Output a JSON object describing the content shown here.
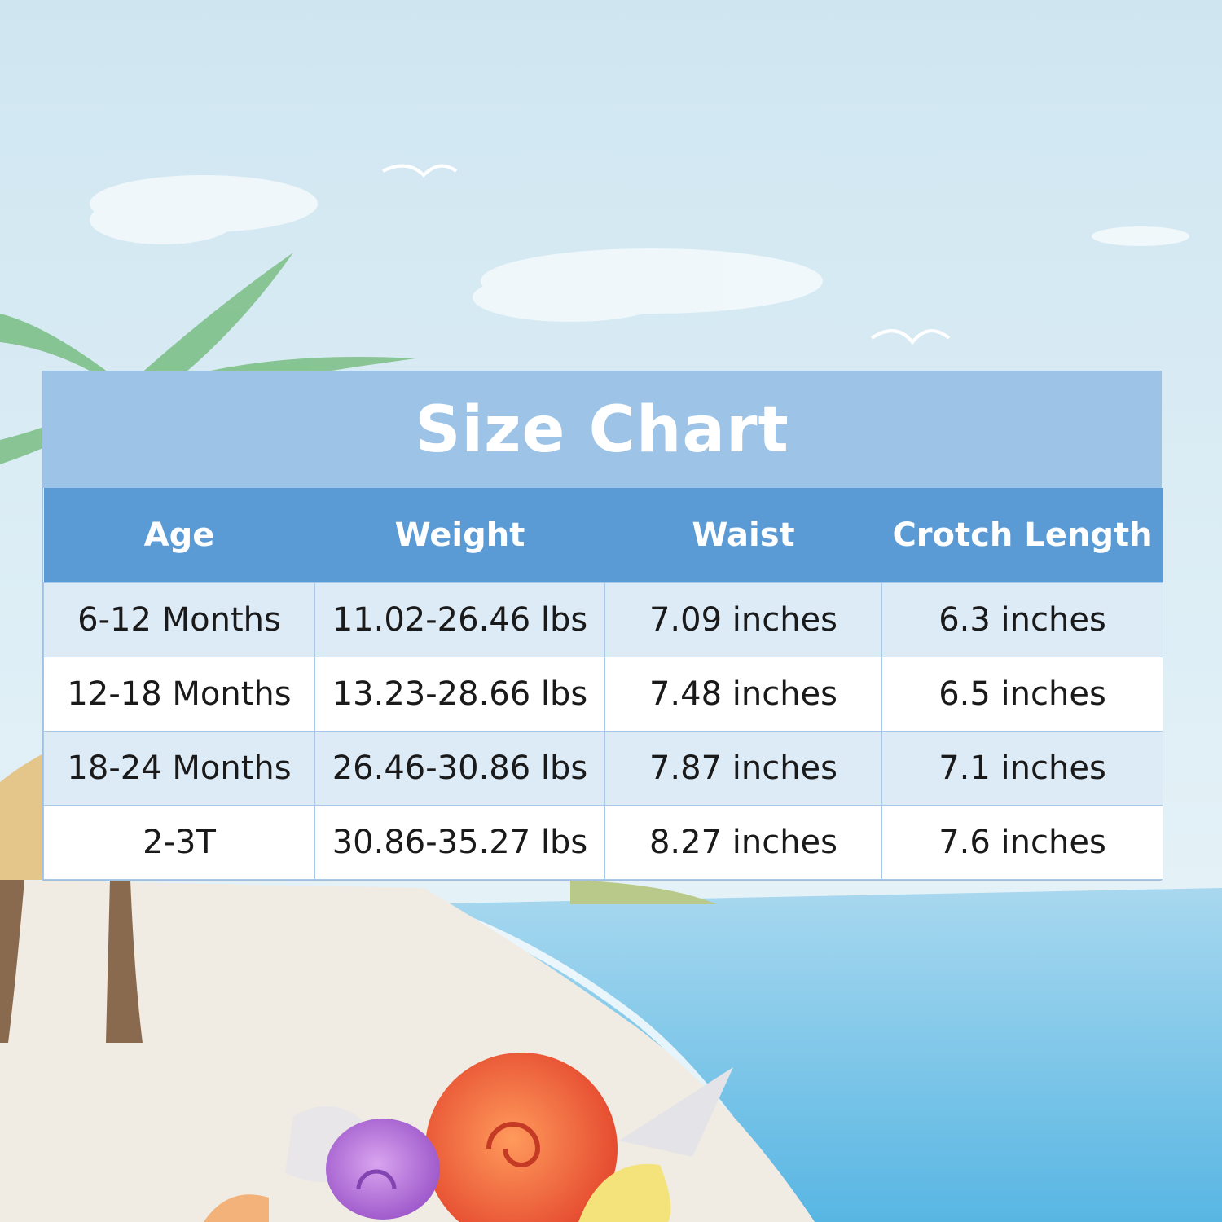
{
  "title": "Size Chart",
  "columns": [
    "Age",
    "Weight",
    "Waist",
    "Crotch Length"
  ],
  "rows": [
    {
      "age": "6-12 Months",
      "weight": "11.02-26.46 lbs",
      "waist": "7.09 inches",
      "crotch": "6.3 inches"
    },
    {
      "age": "12-18 Months",
      "weight": "13.23-28.66 lbs",
      "waist": "7.48 inches",
      "crotch": "6.5 inches"
    },
    {
      "age": "18-24 Months",
      "weight": "26.46-30.86 lbs",
      "waist": "7.87 inches",
      "crotch": "7.1 inches"
    },
    {
      "age": "2-3T",
      "weight": "30.86-35.27 lbs",
      "waist": "8.27 inches",
      "crotch": "7.6 inches"
    }
  ],
  "colors": {
    "title_bg": "#9dc3e6",
    "header_bg": "#5b9bd5",
    "row_shaded": "#ddebf7",
    "row_plain": "#ffffff",
    "sky": "#dceef6",
    "sea": "#7cc6e6",
    "sand": "#efeae2"
  },
  "background_illustration": [
    "sky",
    "clouds",
    "palm-tree",
    "beach",
    "sea",
    "seashells"
  ]
}
